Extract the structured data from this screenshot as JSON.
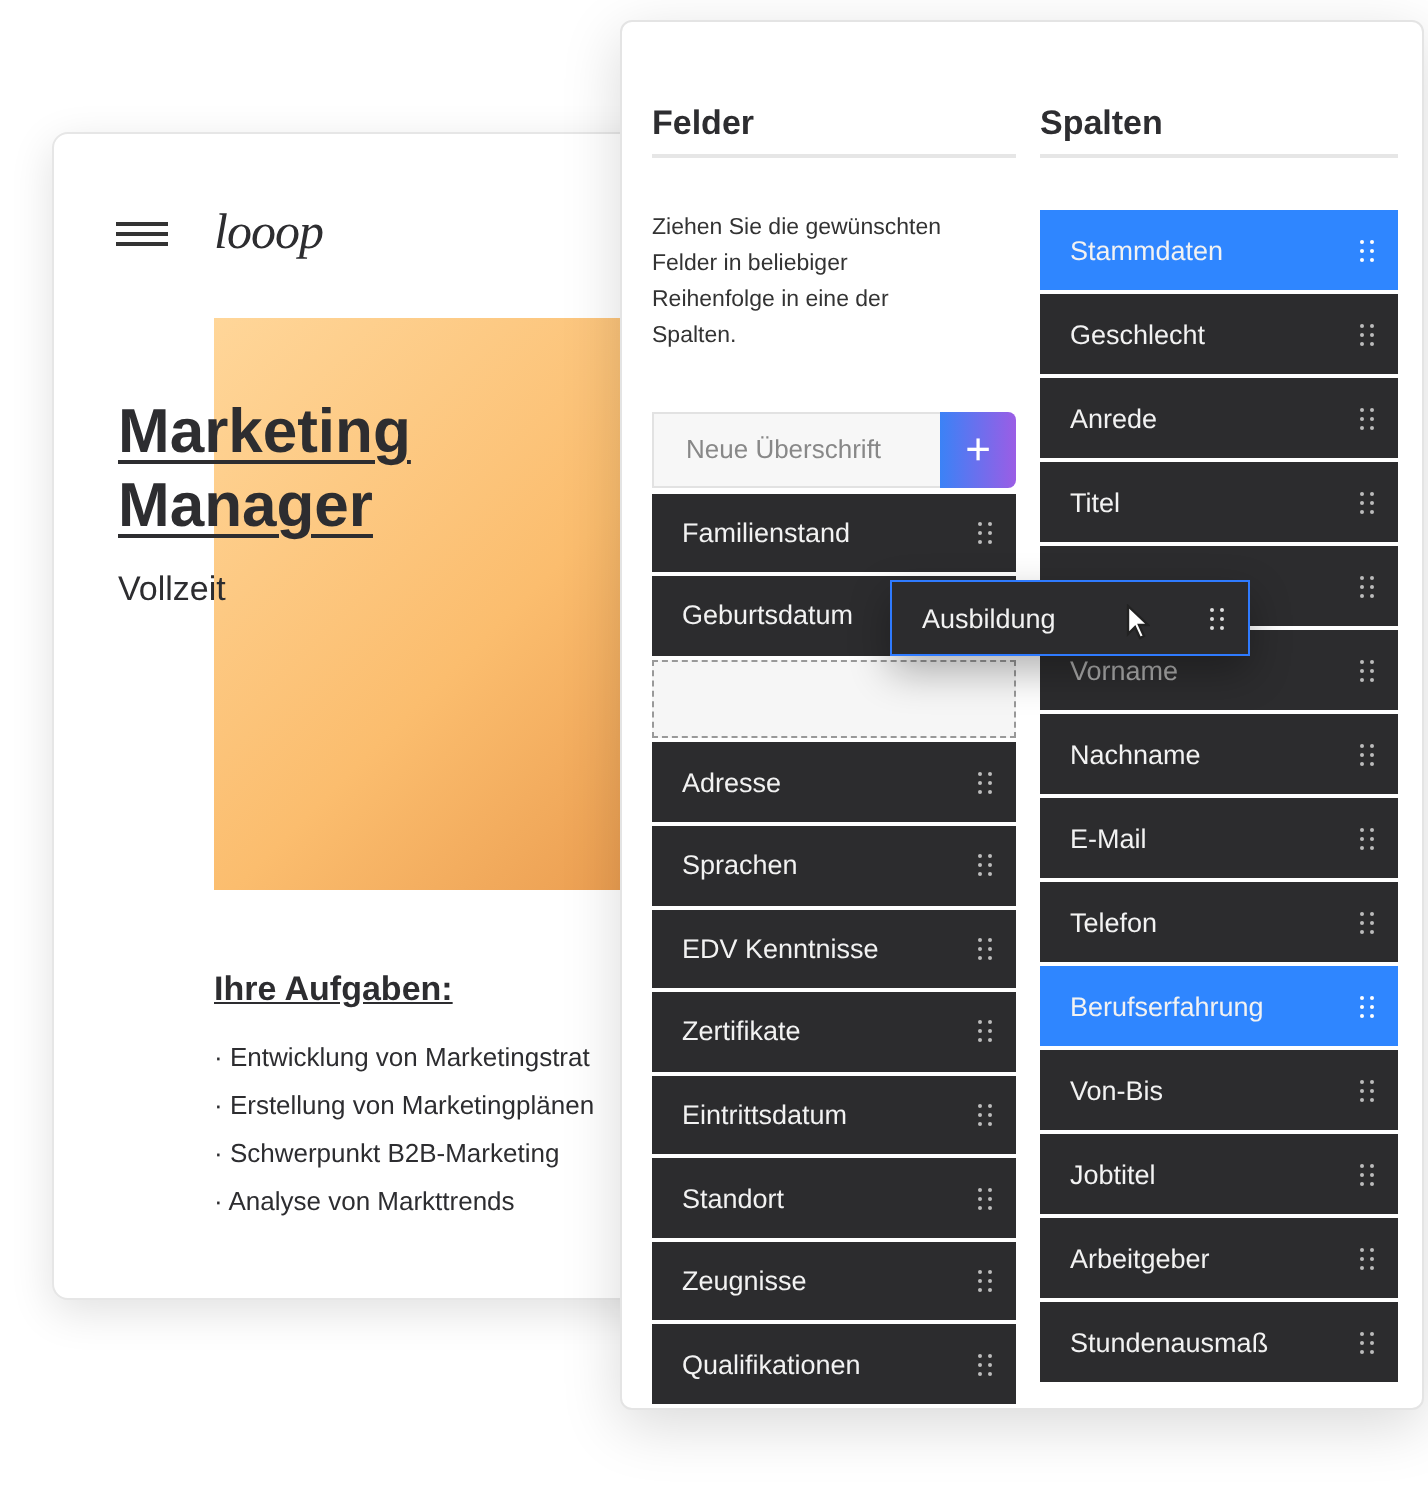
{
  "job_card": {
    "logo": "looop",
    "title_lines": [
      "Marketing",
      "Manager"
    ],
    "employment": "Vollzeit",
    "tasks_heading": "Ihre Aufgaben:",
    "tasks": [
      "· Entwicklung von Marketingstrat",
      "· Erstellung von Marketingplänen",
      "· Schwerpunkt B2B-Marketing",
      "· Analyse von Markttrends"
    ]
  },
  "fields_column": {
    "heading": "Felder",
    "description": "Ziehen Sie die gewünschten Felder in beliebiger Reihenfolge in eine der Spalten.",
    "new_heading": {
      "placeholder": "Neue Überschrift",
      "button": "+"
    },
    "items": [
      {
        "kind": "field",
        "label": "Familienstand"
      },
      {
        "kind": "field",
        "label": "Geburtsdatum"
      },
      {
        "kind": "dropzone"
      },
      {
        "kind": "field",
        "label": "Adresse"
      },
      {
        "kind": "field",
        "label": "Sprachen"
      },
      {
        "kind": "field",
        "label": "EDV Kenntnisse"
      },
      {
        "kind": "field",
        "label": "Zertifikate"
      },
      {
        "kind": "field",
        "label": "Eintrittsdatum"
      },
      {
        "kind": "field",
        "label": "Standort"
      },
      {
        "kind": "field",
        "label": "Zeugnisse"
      },
      {
        "kind": "field",
        "label": "Qualifikationen"
      }
    ]
  },
  "columns_column": {
    "heading": "Spalten",
    "items": [
      {
        "kind": "section",
        "label": "Stammdaten",
        "dimmed": false
      },
      {
        "kind": "field",
        "label": "Geschlecht",
        "dimmed": false
      },
      {
        "kind": "field",
        "label": "Anrede",
        "dimmed": false
      },
      {
        "kind": "field",
        "label": "Titel",
        "dimmed": false
      },
      {
        "kind": "field"
      },
      {
        "kind": "field",
        "label": "Vorname",
        "dimmed": true
      },
      {
        "kind": "field",
        "label": "Nachname",
        "dimmed": false
      },
      {
        "kind": "field",
        "label": "E-Mail",
        "dimmed": false
      },
      {
        "kind": "field",
        "label": "Telefon",
        "dimmed": false
      },
      {
        "kind": "section",
        "label": "Berufserfahrung",
        "dimmed": false
      },
      {
        "kind": "field",
        "label": "Von-Bis",
        "dimmed": false
      },
      {
        "kind": "field",
        "label": "Jobtitel",
        "dimmed": false
      },
      {
        "kind": "field",
        "label": "Arbeitgeber",
        "dimmed": false
      },
      {
        "kind": "field",
        "label": "Stundenausmaß",
        "dimmed": false
      }
    ]
  },
  "dragged_item": {
    "label": "Ausbildung"
  }
}
